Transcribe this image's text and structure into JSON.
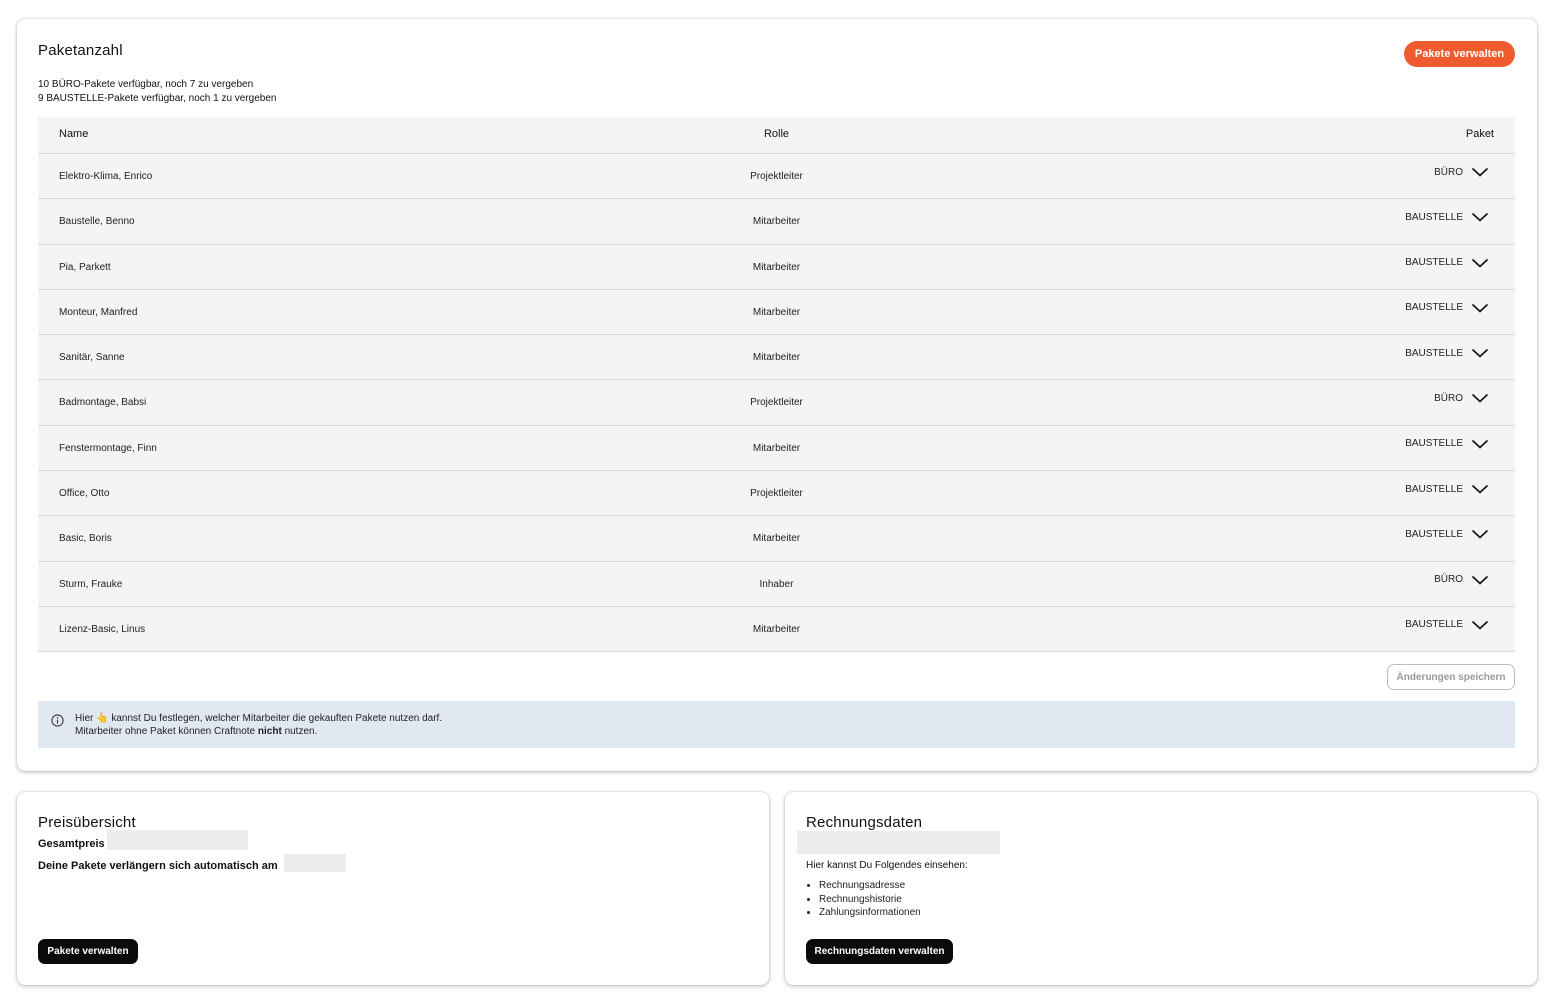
{
  "pakete_card": {
    "title": "Paketanzahl",
    "manage_button": "Pakete verwalten",
    "availability": [
      "10 BÜRO-Pakete verfügbar, noch 7 zu vergeben",
      "9 BAUSTELLE-Pakete verfügbar, noch 1 zu vergeben"
    ],
    "table": {
      "headers": {
        "name": "Name",
        "role": "Rolle",
        "package": "Paket"
      },
      "rows": [
        {
          "name": "Elektro-Klima, Enrico",
          "role": "Projektleiter",
          "package": "BÜRO"
        },
        {
          "name": "Baustelle, Benno",
          "role": "Mitarbeiter",
          "package": "BAUSTELLE"
        },
        {
          "name": "Pia, Parkett",
          "role": "Mitarbeiter",
          "package": "BAUSTELLE"
        },
        {
          "name": "Monteur, Manfred",
          "role": "Mitarbeiter",
          "package": "BAUSTELLE"
        },
        {
          "name": "Sanitär, Sanne",
          "role": "Mitarbeiter",
          "package": "BAUSTELLE"
        },
        {
          "name": "Badmontage, Babsi",
          "role": "Projektleiter",
          "package": "BÜRO"
        },
        {
          "name": "Fenstermontage, Finn",
          "role": "Mitarbeiter",
          "package": "BAUSTELLE"
        },
        {
          "name": "Office, Otto",
          "role": "Projektleiter",
          "package": "BAUSTELLE"
        },
        {
          "name": "Basic, Boris",
          "role": "Mitarbeiter",
          "package": "BAUSTELLE"
        },
        {
          "name": "Sturm, Frauke",
          "role": "Inhaber",
          "package": "BÜRO"
        },
        {
          "name": "Lizenz-Basic, Linus",
          "role": "Mitarbeiter",
          "package": "BAUSTELLE"
        }
      ]
    },
    "save_button": "Änderungen speichern",
    "info": {
      "line1_before": "Hier",
      "hand_emoji": "👆",
      "line1_after": "kannst Du festlegen, welcher Mitarbeiter die gekauften Pakete nutzen darf.",
      "line2_before": "Mitarbeiter ohne Paket können Craftnote",
      "line2_bold": "nicht",
      "line2_after": "nutzen."
    }
  },
  "preis_card": {
    "title": "Preisübersicht",
    "total_label": "Gesamtpreis",
    "renewal_label": "Deine Pakete verlängern sich automatisch am",
    "manage_button": "Pakete verwalten"
  },
  "rechnung_card": {
    "title": "Rechnungsdaten",
    "hint": "Hier kannst Du Folgendes einsehen:",
    "items": [
      "Rechnungsadresse",
      "Rechnungshistorie",
      "Zahlungsinformationen"
    ],
    "manage_button": "Rechnungsdaten verwalten"
  },
  "colors": {
    "accent": "#ef5b2f",
    "info_bg": "#e2e8f2",
    "table_bg": "#f4f4f4",
    "primary_dark": "#0b0b0b"
  },
  "icons": {
    "row_dropdown": "chevron-down-icon",
    "info": "info-circle-icon"
  }
}
